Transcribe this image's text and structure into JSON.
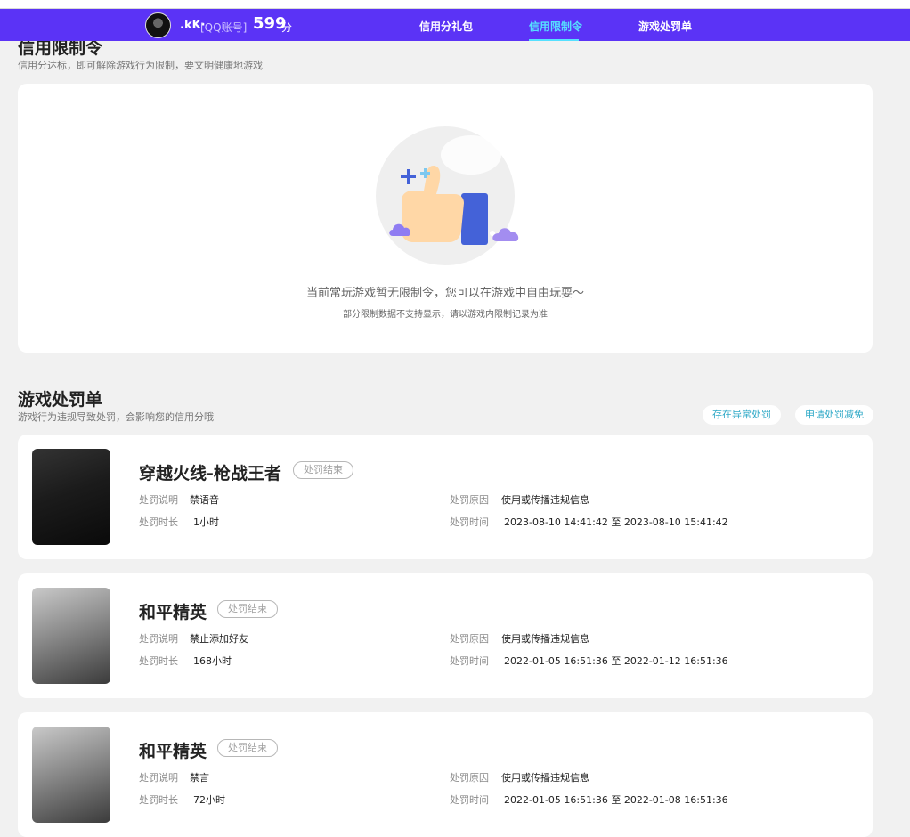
{
  "header": {
    "nickname": ".kK·",
    "account": "[QQ账号]",
    "score": "599",
    "score_unit": "分",
    "nav": [
      "信用分礼包",
      "信用限制令",
      "游戏处罚单"
    ]
  },
  "restriction": {
    "title": "信用限制令",
    "subtitle": "信用分达标，即可解除游戏行为限制，要文明健康地游戏",
    "empty_main": "当前常玩游戏暂无限制令，您可以在游戏中自由玩耍～",
    "empty_note": "部分限制数据不支持显示，请以游戏内限制记录为准"
  },
  "penalty": {
    "title": "游戏处罚单",
    "subtitle": "游戏行为违规导致处罚，会影响您的信用分哦",
    "actions": [
      "存在异常处罚",
      "申请处罚减免"
    ],
    "labels": {
      "desc": "处罚说明",
      "duration": "处罚时长",
      "reason": "处罚原因",
      "time": "处罚时间"
    },
    "records": [
      {
        "game": "穿越火线-枪战王者",
        "status": "处罚结束",
        "desc": "禁语音",
        "duration": "1小时",
        "reason": "使用或传播违规信息",
        "time": "2023-08-10 14:41:42 至 2023-08-10 15:41:42"
      },
      {
        "game": "和平精英",
        "status": "处罚结束",
        "desc": "禁止添加好友",
        "duration": "168小时",
        "reason": "使用或传播违规信息",
        "time": "2022-01-05 16:51:36 至 2022-01-12 16:51:36"
      },
      {
        "game": "和平精英",
        "status": "处罚结束",
        "desc": "禁言",
        "duration": "72小时",
        "reason": "使用或传播违规信息",
        "time": "2022-01-05 16:51:36 至 2022-01-08 16:51:36"
      }
    ]
  },
  "colors": {
    "topbar": "#5b33f6",
    "active_nav": "#56e0ff",
    "link": "#2fa9c7"
  }
}
